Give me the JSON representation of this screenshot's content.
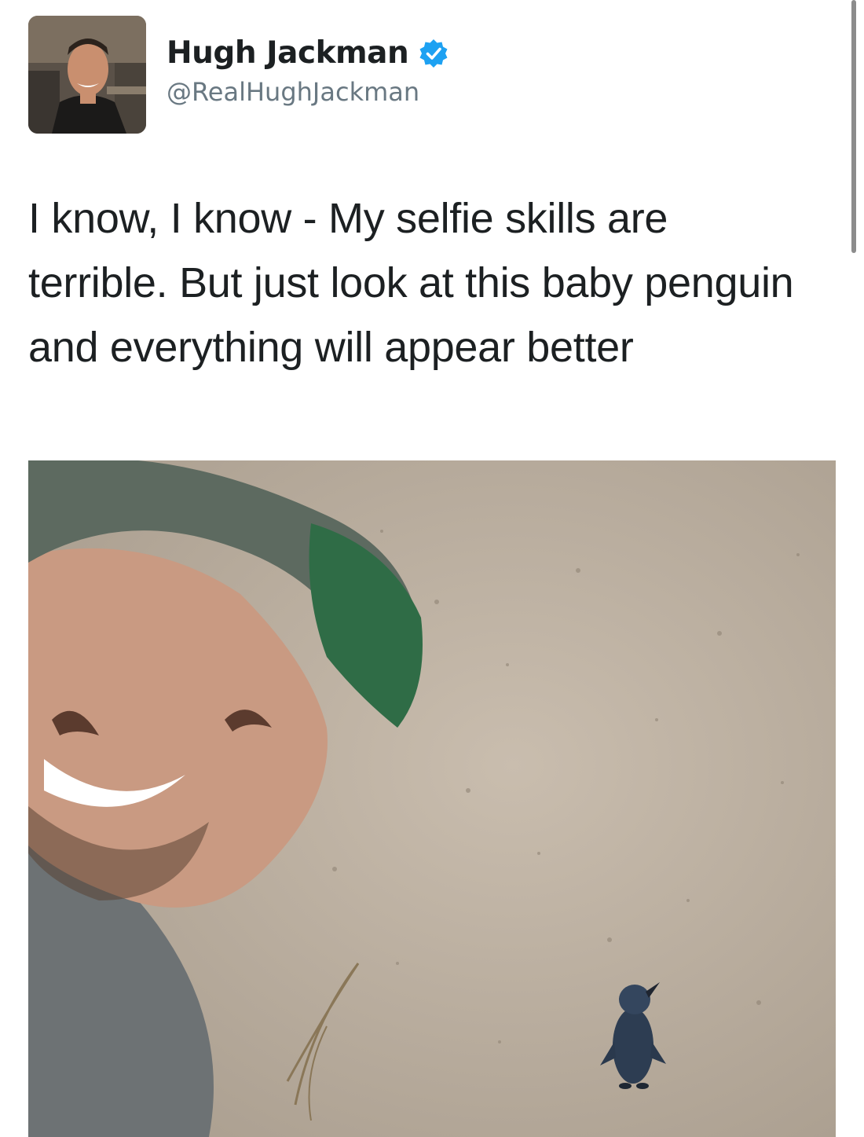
{
  "tweet": {
    "author": {
      "display_name": "Hugh Jackman",
      "handle": "@RealHughJackman",
      "verified": true,
      "verified_icon": "verified-badge-icon",
      "verified_color": "#1da1f2"
    },
    "text": "I know, I know - My selfie skills are terrible. But just look at this baby penguin and everything will appear better"
  },
  "colors": {
    "name_text": "#1c2022",
    "handle_text": "#697882",
    "body_text": "#1c2022",
    "scrollbar": "#8c8c8c"
  }
}
